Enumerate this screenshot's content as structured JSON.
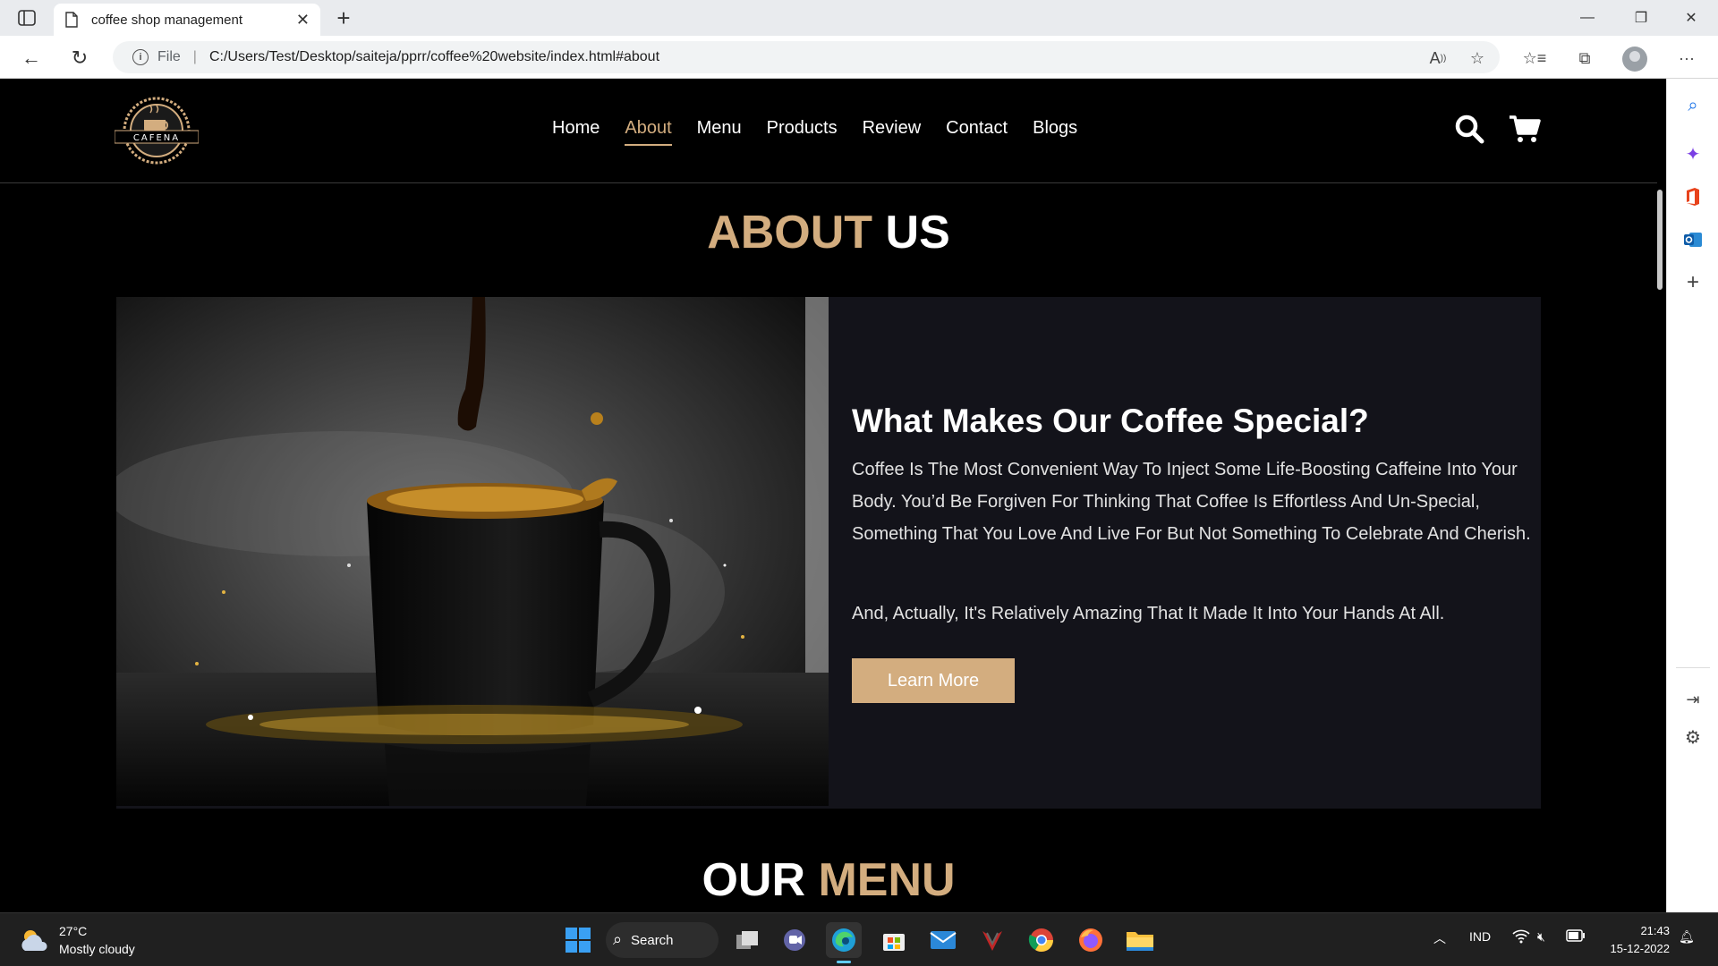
{
  "browser": {
    "tab_title": "coffee shop management",
    "address_prefix": "File",
    "url": "C:/Users/Test/Desktop/saiteja/pprr/coffee%20website/index.html#about"
  },
  "site": {
    "logo_text": "CAFENA",
    "nav": [
      "Home",
      "About",
      "Menu",
      "Products",
      "Review",
      "Contact",
      "Blogs"
    ],
    "active_nav": "About"
  },
  "about": {
    "heading_accent": "ABOUT",
    "heading_plain": "US",
    "title": "What Makes Our Coffee Special?",
    "para1": "Coffee Is The Most Convenient Way To Inject Some Life-Boosting Caffeine Into Your Body. You’d Be Forgiven For Thinking That Coffee Is Effortless And Un-Special, Something That You Love And Live For But Not Something To Celebrate And Cherish.",
    "para2": "And, Actually, It's Relatively Amazing That It Made It Into Your Hands At All.",
    "button": "Learn More"
  },
  "menu_section": {
    "heading_plain": "OUR",
    "heading_accent": "MENU"
  },
  "taskbar": {
    "temperature": "27°C",
    "weather": "Mostly cloudy",
    "search_label": "Search",
    "language": "IND",
    "time": "21:43",
    "date": "15-12-2022"
  },
  "colors": {
    "accent": "#d3ad7f",
    "page_bg": "#000000",
    "card_bg": "#13131a"
  }
}
